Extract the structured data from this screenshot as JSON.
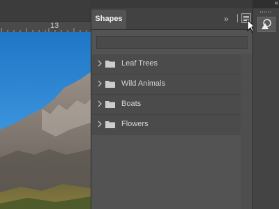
{
  "ruler": {
    "label": "13"
  },
  "panel": {
    "title": "Shapes",
    "collapse_glyph": "»",
    "search": {
      "value": "",
      "placeholder": ""
    },
    "items": [
      {
        "label": "Leaf Trees"
      },
      {
        "label": "Wild Animals"
      },
      {
        "label": "Boats"
      },
      {
        "label": "Flowers"
      }
    ]
  },
  "dock": {
    "collapse_glyph": "«"
  },
  "icons": {
    "folder": "folder-icon",
    "chevron": "chevron-right-icon",
    "menu": "hamburger-menu-icon",
    "shapes": "shapes-icon",
    "cursor": "mouse-pointer-icon"
  },
  "colors": {
    "panel_bg": "#535353",
    "header_bg": "#424242",
    "list_bg": "#4b4b4b",
    "sky": "#2a86d6"
  }
}
